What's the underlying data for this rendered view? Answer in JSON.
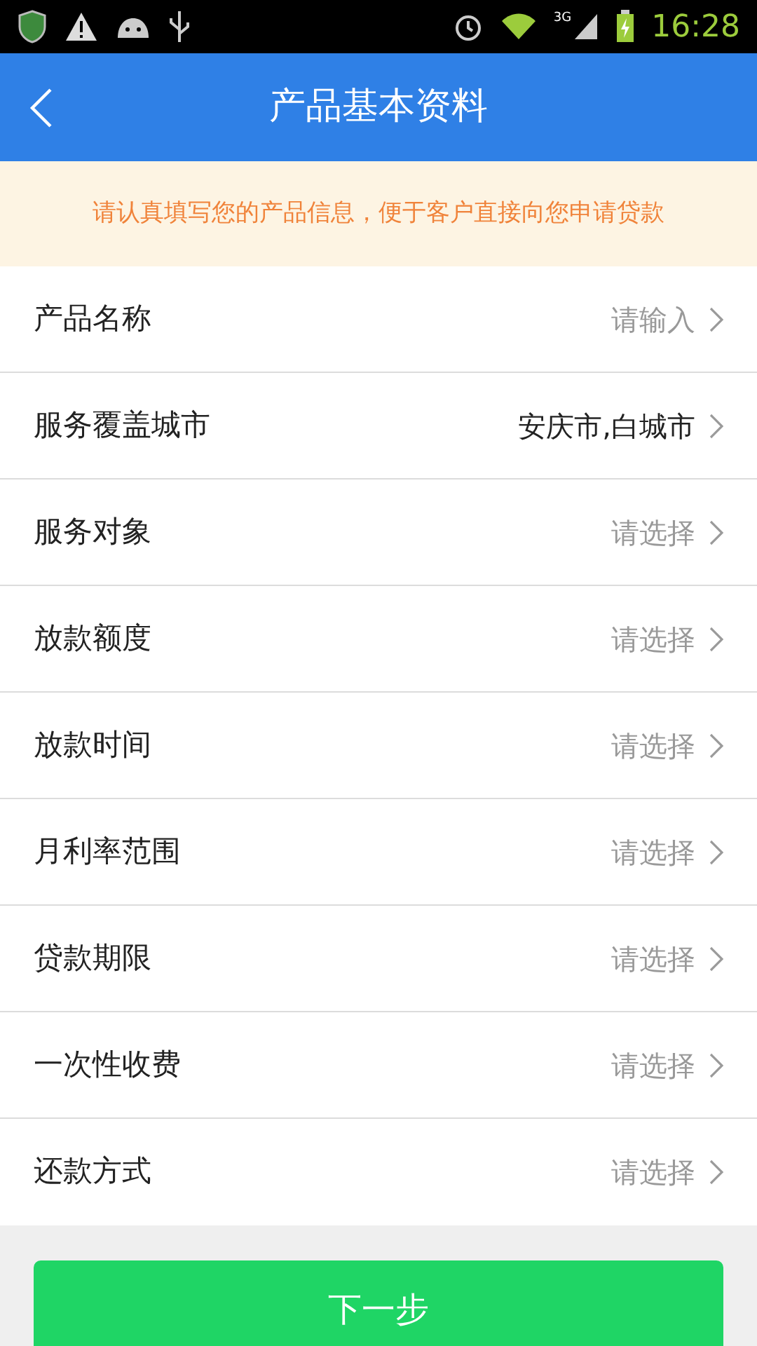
{
  "status_bar": {
    "time": "16:28",
    "network": "3G"
  },
  "header": {
    "title": "产品基本资料"
  },
  "notice": "请认真填写您的产品信息，便于客户直接向您申请贷款",
  "rows": [
    {
      "label": "产品名称",
      "placeholder": "请输入"
    },
    {
      "label": "服务覆盖城市",
      "value": "安庆市,白城市"
    },
    {
      "label": "服务对象",
      "placeholder": "请选择"
    },
    {
      "label": "放款额度",
      "placeholder": "请选择"
    },
    {
      "label": "放款时间",
      "placeholder": "请选择"
    },
    {
      "label": "月利率范围",
      "placeholder": "请选择"
    },
    {
      "label": "贷款期限",
      "placeholder": "请选择"
    },
    {
      "label": "一次性收费",
      "placeholder": "请选择"
    },
    {
      "label": "还款方式",
      "placeholder": "请选择"
    }
  ],
  "next_button": "下一步"
}
